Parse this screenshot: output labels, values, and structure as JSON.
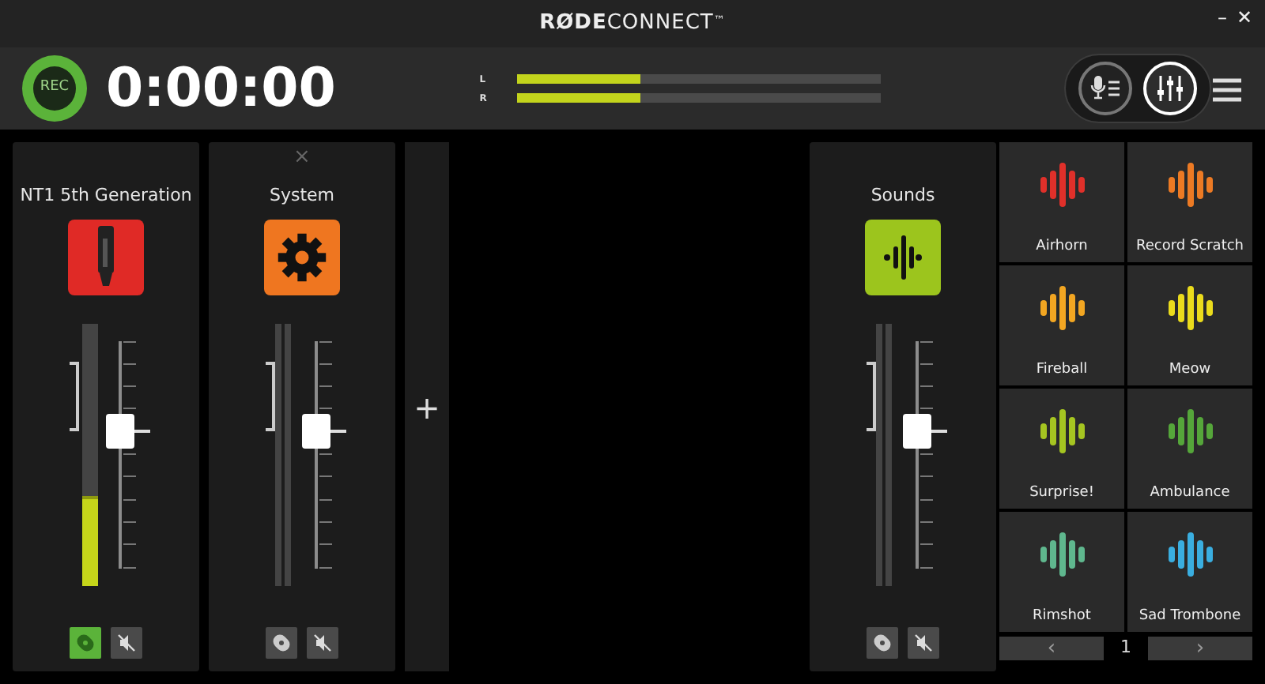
{
  "window": {
    "title": "**RØDE**CONNECT$^{™}$",
    "controls": [
      "–",
      "✕"
    ]
  },
  "header": {
    "rec_label": "REC",
    "timer": "0:00:00",
    "meters": [
      {
        "label": "L",
        "level": 0.34
      },
      {
        "label": "R",
        "level": 0.34
      }
    ],
    "views": [
      {
        "kind": "mic-list",
        "selected": false
      },
      {
        "kind": "mixer",
        "selected": true
      }
    ]
  },
  "channels": [
    {
      "name": "NT1 5th Generation",
      "kind": "mic",
      "color": "#e02a26",
      "meter": {
        "level": 0.34
      },
      "listen": true,
      "muted": false
    },
    {
      "name": "System",
      "kind": "system",
      "color": "#ef7620",
      "close": "×",
      "listen": false,
      "muted": false
    }
  ],
  "add_label": "+",
  "sounds_channel": {
    "name": "Sounds",
    "kind": "sounds",
    "color": "#9cc51d",
    "listen": false,
    "muted": false
  },
  "pads": [
    {
      "label": "Airhorn",
      "color": "#e0302a"
    },
    {
      "label": "Record Scratch",
      "color": "#ec7a24"
    },
    {
      "label": "Fireball",
      "color": "#f2a622"
    },
    {
      "label": "Meow",
      "color": "#eadb1c"
    },
    {
      "label": "Surprise!",
      "color": "#a5c521"
    },
    {
      "label": "Ambulance",
      "color": "#55a63a"
    },
    {
      "label": "Rimshot",
      "color": "#5fb78e"
    },
    {
      "label": "Sad Trombone",
      "color": "#3aaee0"
    }
  ],
  "pager": {
    "page": "1",
    "prev": "‹",
    "next": "›"
  }
}
